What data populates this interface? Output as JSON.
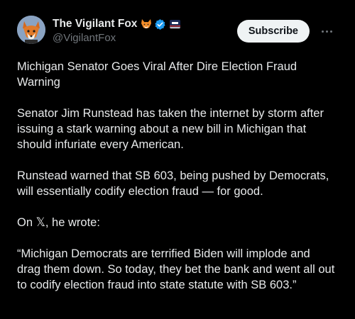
{
  "author": {
    "display_name": "The Vigilant Fox",
    "handle": "@VigilantFox",
    "avatar_icon": "fox-avatar-icon",
    "badges": [
      "fox-emoji-icon",
      "verified-badge-icon",
      "affiliate-badge-icon"
    ]
  },
  "actions": {
    "subscribe_label": "Subscribe",
    "more_icon": "ellipsis-icon"
  },
  "post": {
    "paragraphs": [
      "Michigan Senator Goes Viral After Dire Election Fraud\nWarning",
      "Senator Jim Runstead has taken the internet by storm after\nissuing a stark warning about a new bill in Michigan that\nshould infuriate every American.",
      "Runstead warned that SB 603, being pushed by Democrats,\nwill essentially codify election fraud — for good.",
      "On 𝕏, he wrote:",
      "“Michigan Democrats are terrified Biden will implode and\ndrag them down. So today, they bet the bank and went all out\nto codify election fraud into state statute with SB 603.”"
    ]
  },
  "colors": {
    "background": "#000000",
    "text": "#e7e9ea",
    "secondary": "#71767b",
    "verified": "#1d9bf0",
    "button_bg": "#eff3f4"
  }
}
